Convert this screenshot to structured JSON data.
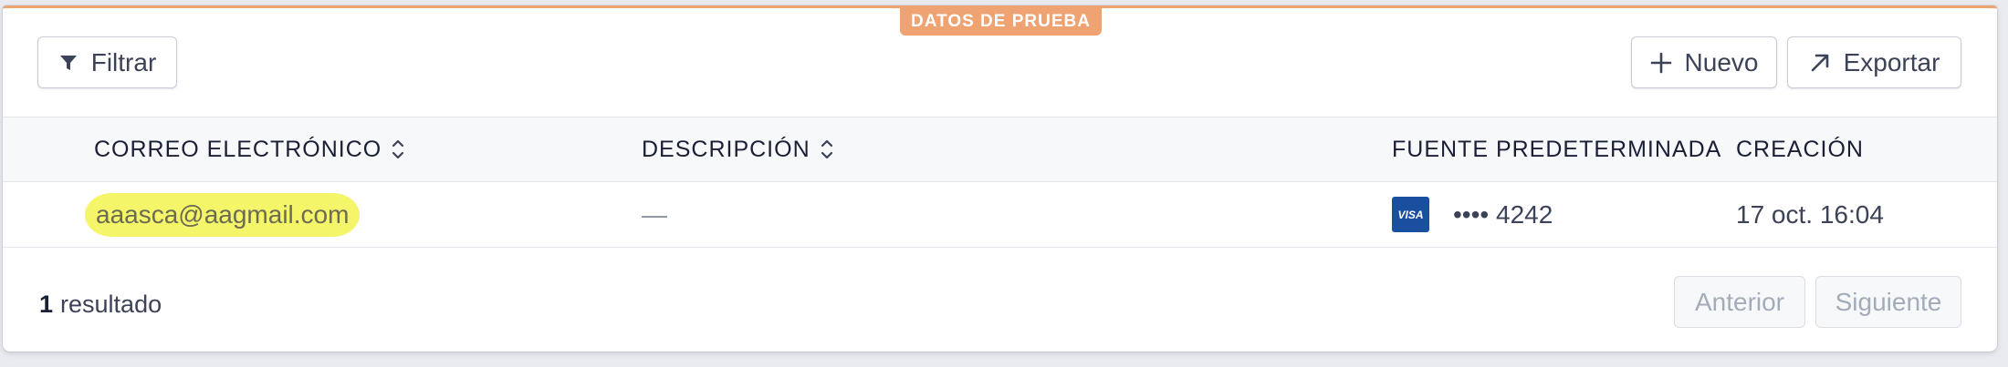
{
  "badge": "DATOS DE PRUEBA",
  "toolbar": {
    "filter_label": "Filtrar",
    "new_label": "Nuevo",
    "export_label": "Exportar"
  },
  "table": {
    "columns": [
      {
        "label": "CORREO ELECTRÓNICO",
        "sortable": true
      },
      {
        "label": "DESCRIPCIÓN",
        "sortable": true
      },
      {
        "label": "FUENTE PREDETERMINADA",
        "sortable": false
      },
      {
        "label": "CREACIÓN",
        "sortable": false
      }
    ],
    "rows": [
      {
        "email": "aaasca@aagmail.com",
        "description": "—",
        "card_brand": "VISA",
        "card_masked": "•••• 4242",
        "created": "17 oct. 16:04"
      }
    ]
  },
  "footer": {
    "count": "1",
    "count_label": "resultado",
    "prev_label": "Anterior",
    "next_label": "Siguiente"
  },
  "colors": {
    "test_accent": "#f0a372",
    "highlight": "#f5f56a",
    "visa_blue": "#1a4fa0"
  },
  "icons": {
    "filter": "filter-icon",
    "new": "plus-icon",
    "export": "arrow-up-right-icon",
    "sort": "sort-icon"
  }
}
